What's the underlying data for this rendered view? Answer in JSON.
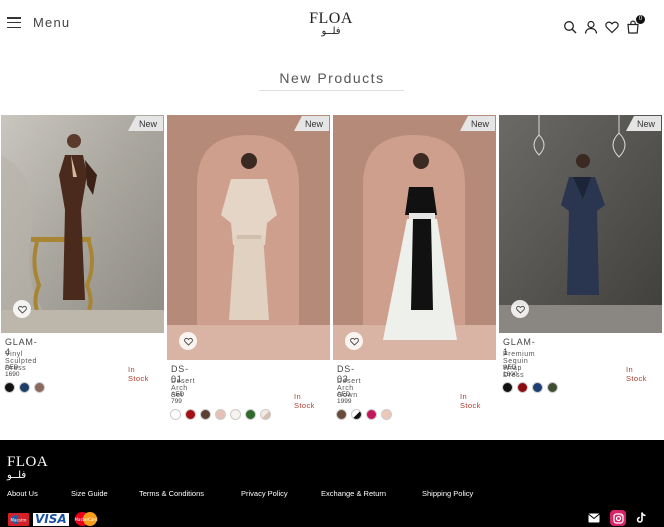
{
  "header": {
    "menu_label": "Menu",
    "logo_text": "FLOA",
    "logo_arabic": "فلــو",
    "cart_count": "0",
    "icons": [
      "search-icon",
      "user-icon",
      "heart-icon",
      "cart-icon"
    ]
  },
  "section": {
    "title": "New Products"
  },
  "products": [
    {
      "code": "GLAM-4",
      "name": "Vinyl Sculpted Dress",
      "price": "AED 1690",
      "stock": "In Stock",
      "badge": "New",
      "swatches": [
        "#111111",
        "#1d3e6b",
        "#8a6a5e"
      ]
    },
    {
      "code": "DS-01",
      "name": "Desert Arch Set",
      "price": "AED 799",
      "stock": "In Stock",
      "badge": "New",
      "swatches": [
        "#ffffff",
        "#a30f15",
        "#5c3f33",
        "#e3c1b6",
        "#f6f2ee",
        "#2f6a2a",
        "#e8d8cc"
      ]
    },
    {
      "code": "DS-03",
      "name": "Desert Arch Gown",
      "price": "AED 1999",
      "stock": "In Stock",
      "badge": "New",
      "swatches": [
        "#6a4a38",
        "#111111",
        "#c2185b",
        "#ebc8b9"
      ]
    },
    {
      "code": "GLAM-1",
      "name": "Premium Sequin Wrap Dress",
      "price": "AED 1800",
      "stock": "In Stock",
      "badge": "New",
      "swatches": [
        "#111111",
        "#8b0b10",
        "#1e3f72",
        "#3d4f30"
      ]
    }
  ],
  "footer": {
    "logo_text": "FLOA",
    "logo_arabic": "فلــو",
    "links": [
      "About Us",
      "Size Guide",
      "Terms & Conditions",
      "Privacy Policy",
      "Exchange & Return",
      "Shipping Policy"
    ],
    "payment": [
      "Maestro",
      "VISA",
      "MasterCard"
    ],
    "social": [
      "email-icon",
      "instagram-icon",
      "tiktok-icon"
    ],
    "instagram_color": "#d6246b"
  }
}
